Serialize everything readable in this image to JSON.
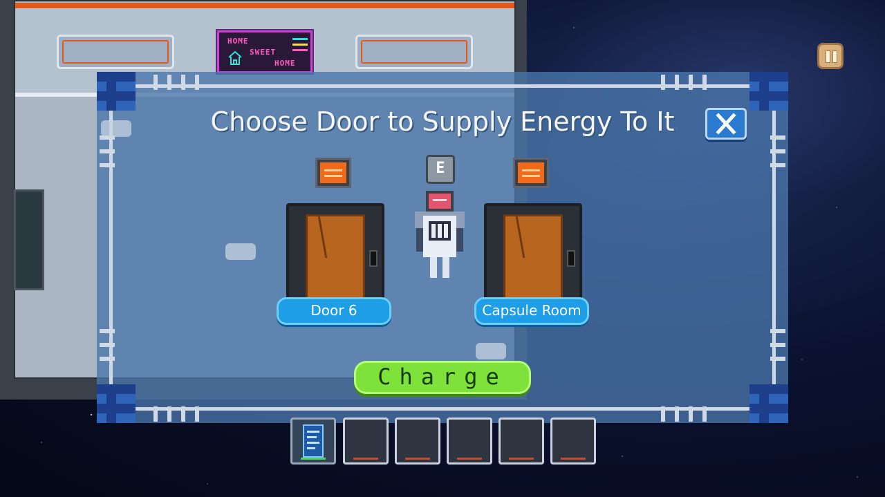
{
  "background_sign": {
    "line1": "HOME",
    "line2": "SWEET",
    "line3": "HOME"
  },
  "dialog": {
    "title": "Choose Door to Supply Energy To It",
    "close_icon": "close-icon",
    "key_hint": "E",
    "doors": [
      {
        "label": "Door 6"
      },
      {
        "label": "Capsule Room"
      }
    ],
    "charge_label": "Charge"
  },
  "inventory": {
    "slots": [
      {
        "item": "datapad-icon",
        "active": true
      },
      {
        "item": "",
        "active": false
      },
      {
        "item": "",
        "active": false
      },
      {
        "item": "",
        "active": false
      },
      {
        "item": "",
        "active": false
      },
      {
        "item": "",
        "active": false
      }
    ]
  },
  "hud": {
    "pause_icon": "pause-icon"
  },
  "colors": {
    "door_label_bg": "#1f9ee8",
    "charge_bg": "#7fe23a",
    "close_bg": "#2a7ad0",
    "accent_orange": "#e35a1a",
    "sign_pink": "#ff5bbf"
  }
}
